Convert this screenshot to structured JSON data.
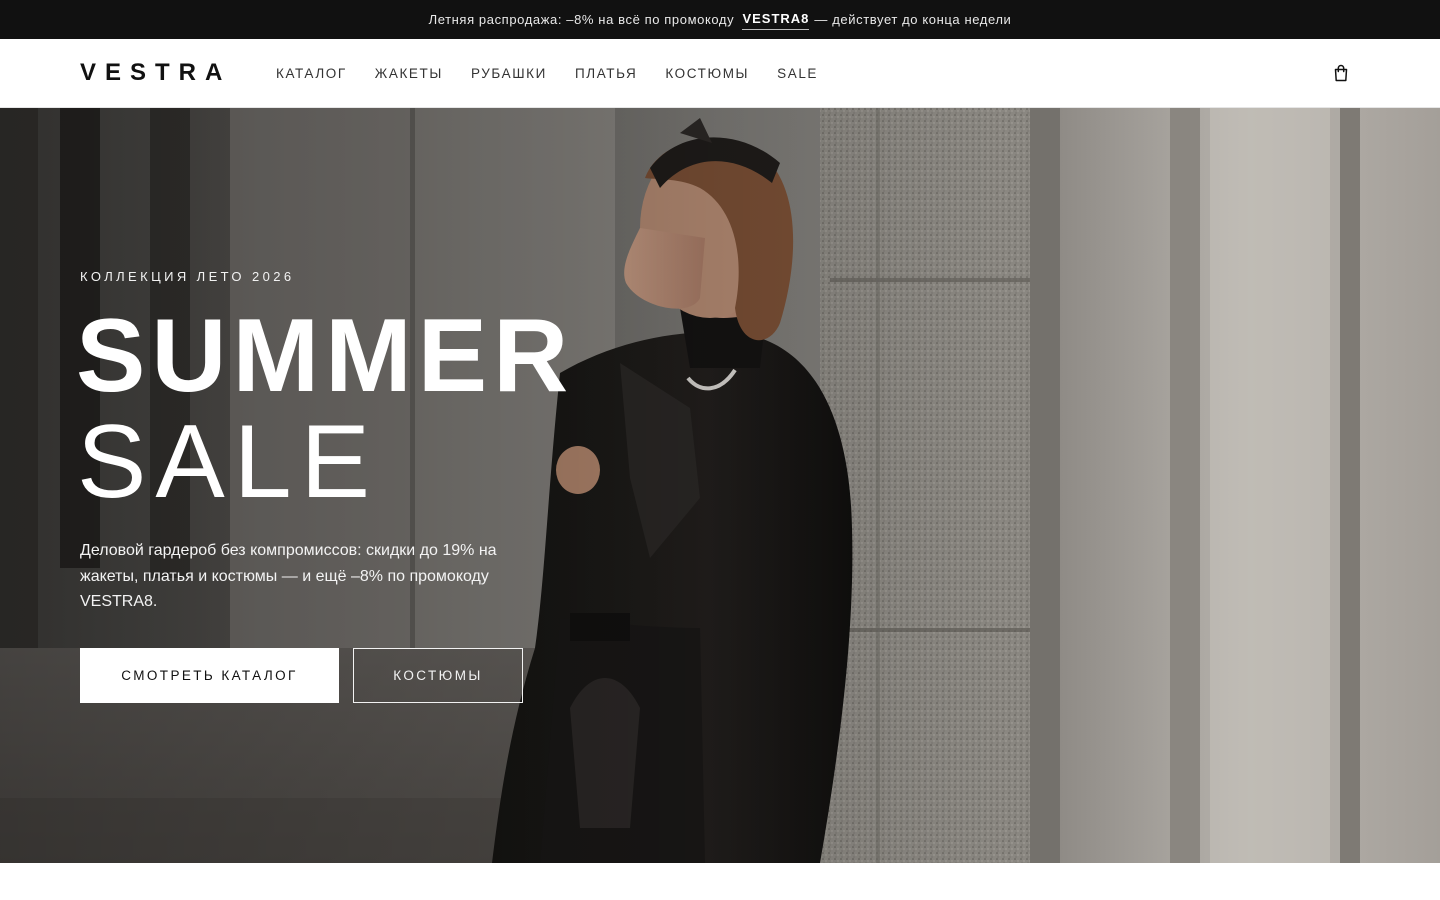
{
  "announcement": {
    "before": "Летняя распродажа: –8% на всё по промокоду",
    "code": "VESTRA8",
    "after": "— действует до конца недели"
  },
  "header": {
    "logo": "VESTRA",
    "nav": [
      "КАТАЛОГ",
      "ЖАКЕТЫ",
      "РУБАШКИ",
      "ПЛАТЬЯ",
      "КОСТЮМЫ",
      "SALE"
    ],
    "cart_icon": "shopping-bag-icon"
  },
  "hero": {
    "eyebrow": "КОЛЛЕКЦИЯ ЛЕТО 2026",
    "title_line1": "SUMMER",
    "title_line2": "SALE",
    "lead": "Деловой гардероб без компромиссов: скидки до 19% на жакеты, платья и костюмы — и ещё –8% по промокоду VESTRA8.",
    "primary_cta": "СМОТРЕТЬ КАТАЛОГ",
    "secondary_cta": "КОСТЮМЫ"
  },
  "colors": {
    "announcement_bg": "#111111",
    "header_bg": "#ffffff",
    "text_dark": "#111111",
    "hero_text": "#ffffff"
  }
}
